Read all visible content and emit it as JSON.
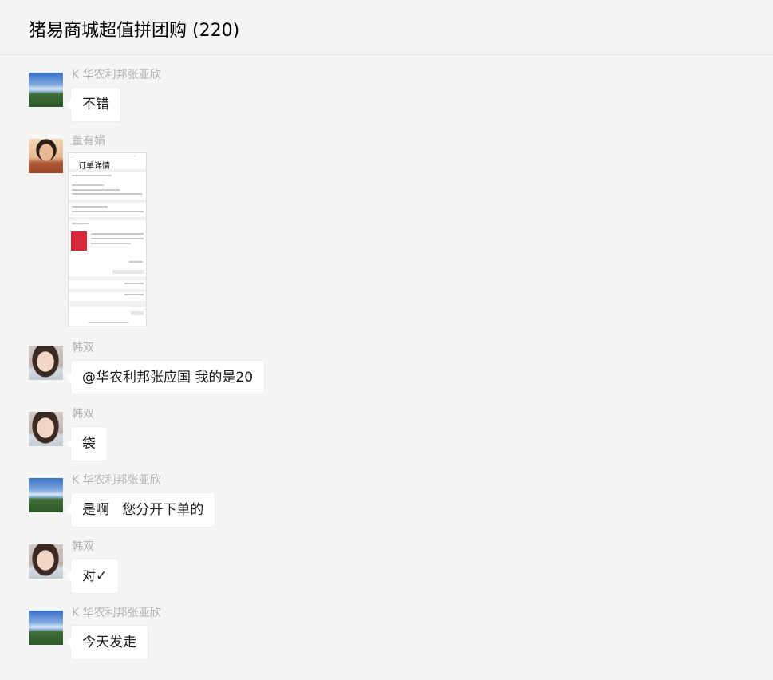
{
  "header": {
    "title": "猪易商城超值拼团购 (220)"
  },
  "messages": [
    {
      "sender": "K 华农利邦张亚欣",
      "text": "不错",
      "avatar": "landscape-avatar"
    },
    {
      "sender": "董有娟",
      "image": "order-details-screenshot",
      "image_title": "订单详情",
      "avatar": "person-avatar"
    },
    {
      "sender": "韩双",
      "text": "@华农利邦张应国 我的是20",
      "avatar": "person-avatar"
    },
    {
      "sender": "韩双",
      "text": "袋",
      "avatar": "person-avatar"
    },
    {
      "sender": "K 华农利邦张亚欣",
      "text": "是啊   您分开下单的",
      "avatar": "landscape-avatar"
    },
    {
      "sender": "韩双",
      "text": "对✓",
      "avatar": "person-avatar"
    },
    {
      "sender": "K 华农利邦张亚欣",
      "text": "今天发走",
      "avatar": "landscape-avatar"
    }
  ]
}
